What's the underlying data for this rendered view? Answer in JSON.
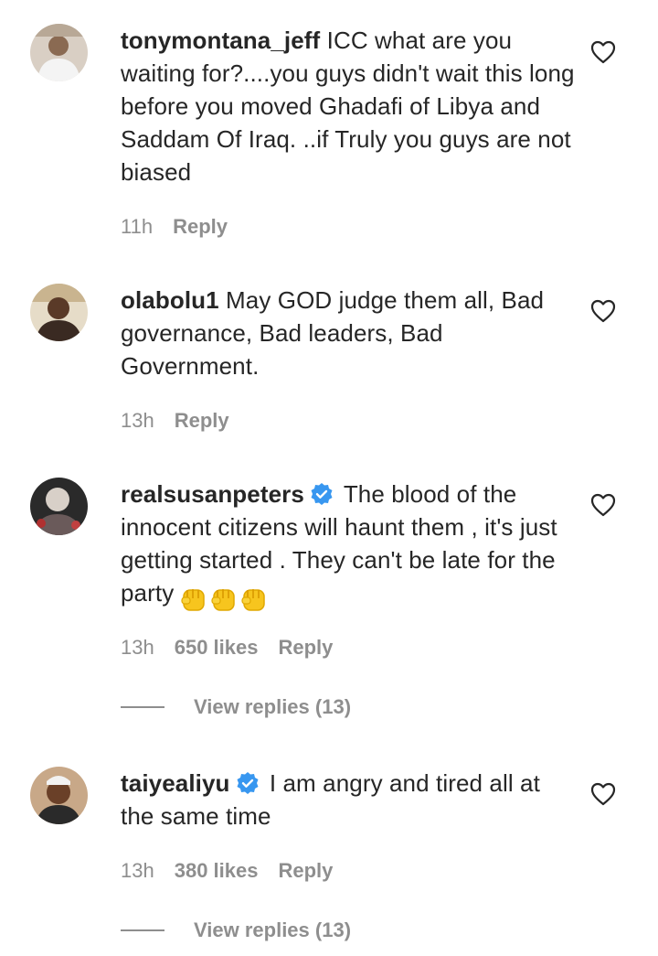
{
  "comments": [
    {
      "username": "tonymontana_jeff",
      "verified": false,
      "text": "ICC what are you waiting for?....you guys didn't wait this long before you moved Ghadafi of Libya and Saddam Of Iraq. ..if Truly you guys are not biased",
      "time": "11h",
      "likes": "",
      "reply_label": "Reply",
      "avatar_icon": "user-avatar-photo"
    },
    {
      "username": "olabolu1",
      "verified": false,
      "text": "May GOD judge them all, Bad governance, Bad leaders, Bad Government.",
      "time": "13h",
      "likes": "",
      "reply_label": "Reply",
      "avatar_icon": "user-avatar-photo"
    },
    {
      "username": "realsusanpeters",
      "verified": true,
      "text": "The blood of the innocent citizens will haunt them , it's just getting started . They can't be late for the party",
      "emoji": "✊✊✊",
      "time": "13h",
      "likes": "650 likes",
      "reply_label": "Reply",
      "view_replies": "View replies (13)",
      "avatar_icon": "user-avatar-photo"
    },
    {
      "username": "taiyealiyu",
      "verified": true,
      "text": "I am angry and tired all at the same time",
      "time": "13h",
      "likes": "380 likes",
      "reply_label": "Reply",
      "view_replies": "View replies (13)",
      "avatar_icon": "user-avatar-photo"
    }
  ],
  "colors": {
    "text": "#262626",
    "muted": "#8e8e8e",
    "verified_blue": "#3897f0"
  }
}
